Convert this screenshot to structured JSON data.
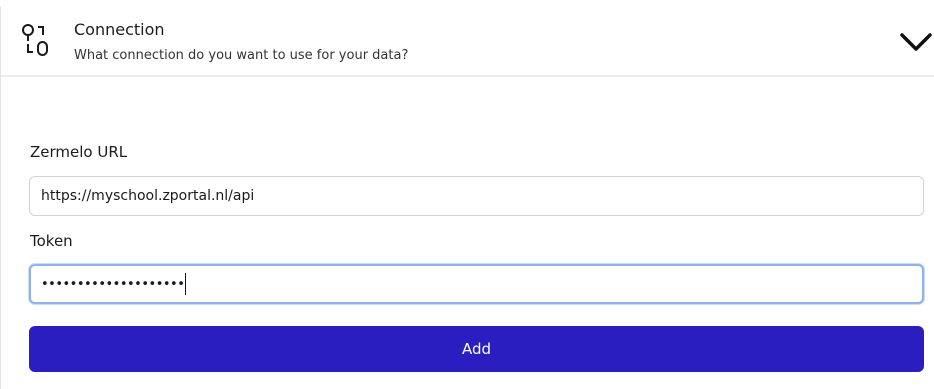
{
  "header": {
    "title": "Connection",
    "subtitle": "What connection do you want to use for your data?",
    "icon": "connection-icon",
    "toggle_icon": "chevron-down-icon"
  },
  "form": {
    "url_label": "Zermelo URL",
    "url_value": "https://myschool.zportal.nl/api",
    "token_label": "Token",
    "token_masked": "••••••••••••••••••••"
  },
  "actions": {
    "add_label": "Add"
  },
  "colors": {
    "primary_button": "#2a1ec1",
    "focus_border": "#8fb2e8"
  }
}
